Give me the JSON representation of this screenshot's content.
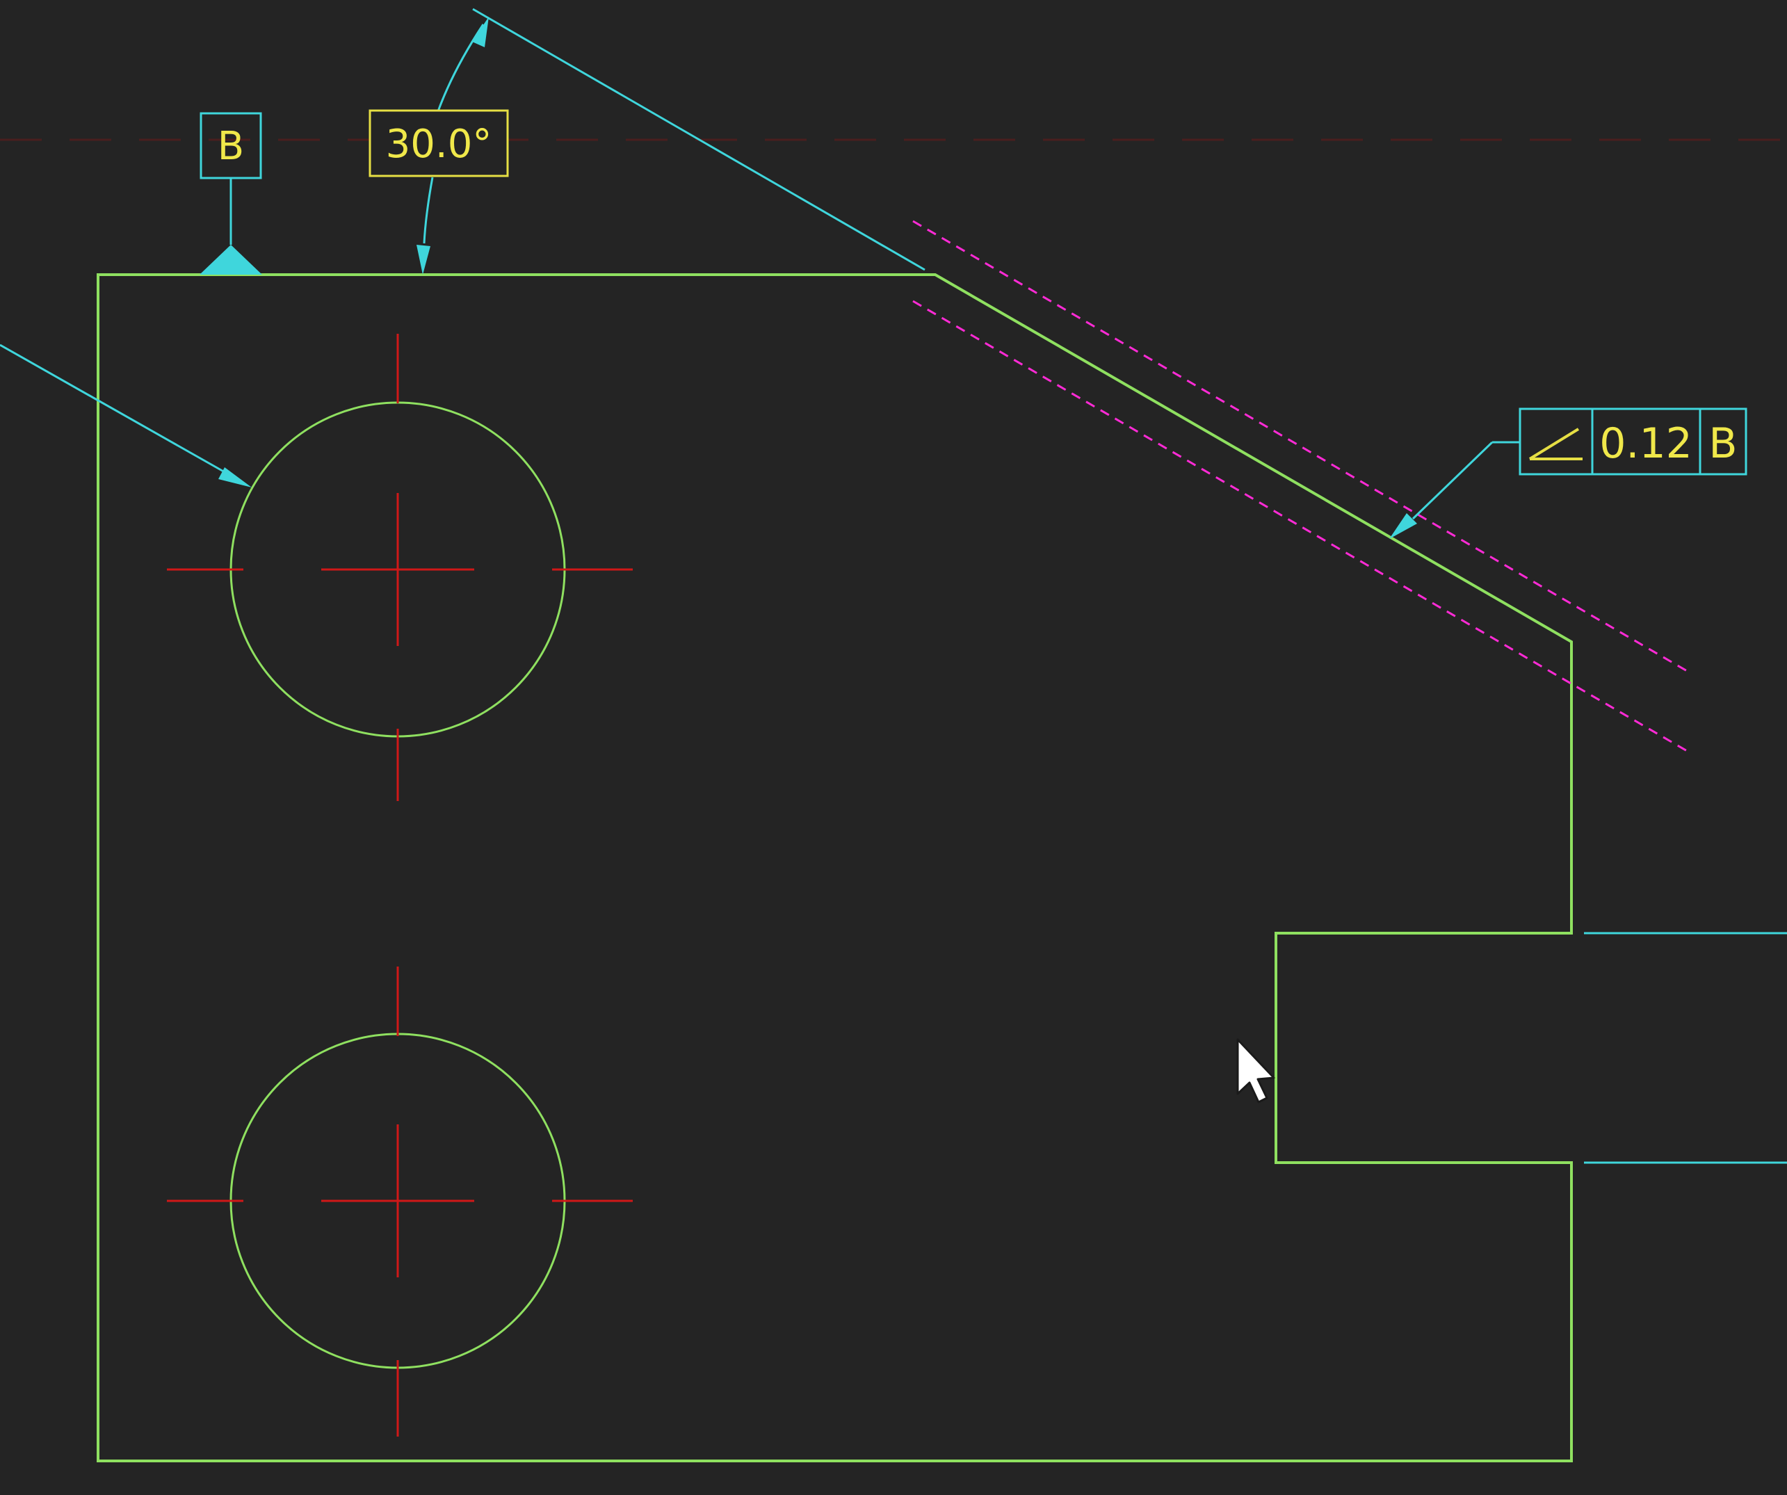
{
  "canvas": {
    "background": "#242424"
  },
  "colors": {
    "geometry": "#8fe060",
    "annotation": "#3fd6dc",
    "centerline": "#d01818",
    "tolerance_zone": "#ff2bd6",
    "annotation_text": "#f0e84a",
    "label_frame_angle": "#e6df44",
    "cursor": "#ffffff"
  },
  "datum_label": {
    "letter": "B"
  },
  "angle_dimension": {
    "value": "30.0°"
  },
  "feature_control_frame": {
    "symbol": "angularity-symbol",
    "tolerance": "0.12",
    "datum": "B"
  },
  "cursor": {
    "icon": "arrow-cursor-icon"
  }
}
